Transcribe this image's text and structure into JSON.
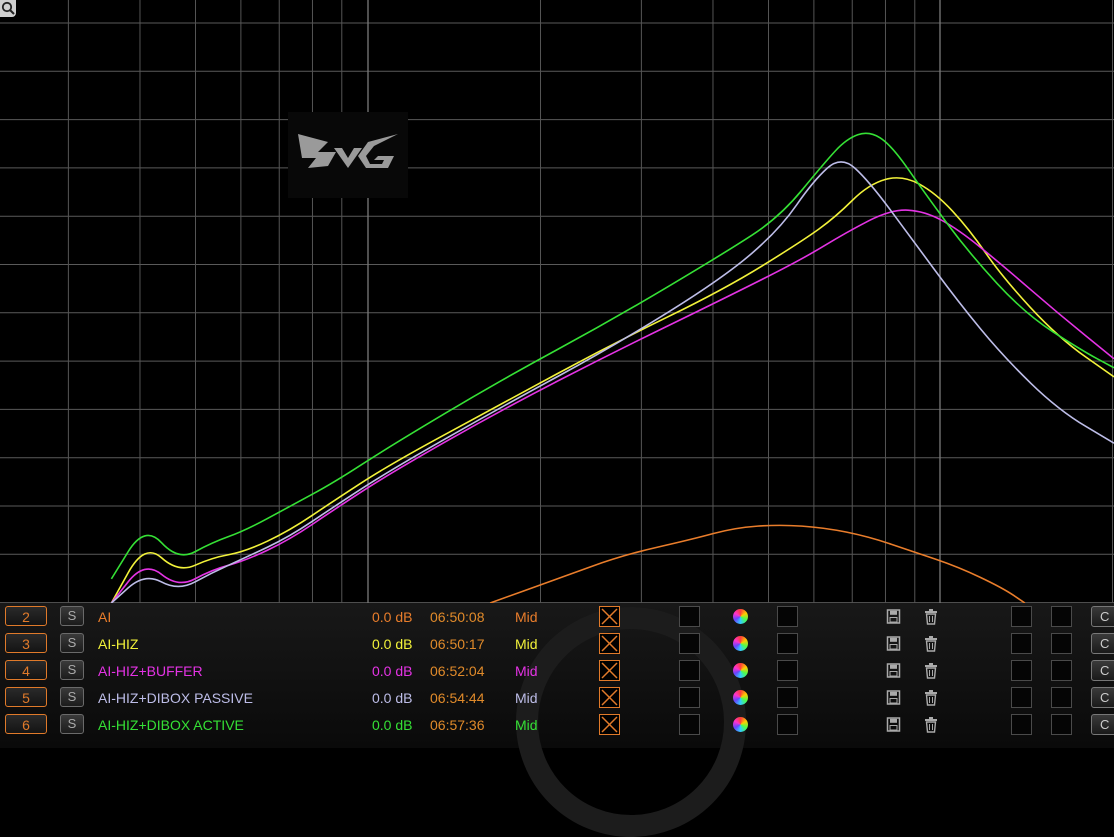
{
  "toolbar": {
    "zoom_icon": "magnifier-icon"
  },
  "logo": {
    "icon": "brand-logo-icon"
  },
  "traces": [
    {
      "number": "2",
      "solo_label": "S",
      "name": "AI",
      "level": "0.0 dB",
      "time": "06:50:08",
      "smoothing": "Mid",
      "color": "#e97d2b"
    },
    {
      "number": "3",
      "solo_label": "S",
      "name": "AI-HIZ",
      "level": "0.0 dB",
      "time": "06:50:17",
      "smoothing": "Mid",
      "color": "#f2f23a"
    },
    {
      "number": "4",
      "solo_label": "S",
      "name": "AI-HIZ+BUFFER",
      "level": "0.0 dB",
      "time": "06:52:04",
      "smoothing": "Mid",
      "color": "#e433e4"
    },
    {
      "number": "5",
      "solo_label": "S",
      "name": "AI-HIZ+DIBOX PASSIVE",
      "level": "0.0 dB",
      "time": "06:54:44",
      "smoothing": "Mid",
      "color": "#bdbde8"
    },
    {
      "number": "6",
      "solo_label": "S",
      "name": "AI-HIZ+DIBOX ACTIVE",
      "level": "0.0 dB",
      "time": "06:57:36",
      "smoothing": "Mid",
      "color": "#35e035"
    }
  ],
  "row_edge_button_label": "C",
  "chart_data": {
    "type": "line",
    "grid": true,
    "x_scale": "log",
    "series": [
      {
        "name": "AI",
        "color": "#e97d2b",
        "points": [
          [
            0.44,
            1.0
          ],
          [
            0.5,
            0.96
          ],
          [
            0.56,
            0.92
          ],
          [
            0.62,
            0.895
          ],
          [
            0.66,
            0.875
          ],
          [
            0.7,
            0.87
          ],
          [
            0.74,
            0.875
          ],
          [
            0.78,
            0.89
          ],
          [
            0.82,
            0.915
          ],
          [
            0.86,
            0.94
          ],
          [
            0.9,
            0.975
          ],
          [
            0.92,
            1.0
          ]
        ]
      },
      {
        "name": "AI-HIZ",
        "color": "#f2f23a",
        "points": [
          [
            0.1,
            1.0
          ],
          [
            0.13,
            0.9
          ],
          [
            0.16,
            0.95
          ],
          [
            0.19,
            0.925
          ],
          [
            0.22,
            0.915
          ],
          [
            0.26,
            0.88
          ],
          [
            0.3,
            0.83
          ],
          [
            0.35,
            0.77
          ],
          [
            0.45,
            0.67
          ],
          [
            0.55,
            0.57
          ],
          [
            0.65,
            0.48
          ],
          [
            0.72,
            0.4
          ],
          [
            0.75,
            0.36
          ],
          [
            0.78,
            0.305
          ],
          [
            0.81,
            0.29
          ],
          [
            0.84,
            0.32
          ],
          [
            0.87,
            0.38
          ],
          [
            0.9,
            0.46
          ],
          [
            0.95,
            0.56
          ],
          [
            1.0,
            0.625
          ]
        ]
      },
      {
        "name": "AI-HIZ+BUFFER",
        "color": "#e433e4",
        "points": [
          [
            0.1,
            1.0
          ],
          [
            0.13,
            0.93
          ],
          [
            0.16,
            0.975
          ],
          [
            0.19,
            0.945
          ],
          [
            0.22,
            0.93
          ],
          [
            0.26,
            0.895
          ],
          [
            0.3,
            0.845
          ],
          [
            0.35,
            0.785
          ],
          [
            0.45,
            0.68
          ],
          [
            0.55,
            0.585
          ],
          [
            0.65,
            0.495
          ],
          [
            0.72,
            0.43
          ],
          [
            0.76,
            0.385
          ],
          [
            0.8,
            0.347
          ],
          [
            0.83,
            0.35
          ],
          [
            0.86,
            0.38
          ],
          [
            0.9,
            0.44
          ],
          [
            0.95,
            0.52
          ],
          [
            1.0,
            0.595
          ]
        ]
      },
      {
        "name": "AI-HIZ+DIBOX PASSIVE",
        "color": "#bdbde8",
        "points": [
          [
            0.1,
            1.0
          ],
          [
            0.13,
            0.95
          ],
          [
            0.16,
            0.98
          ],
          [
            0.19,
            0.95
          ],
          [
            0.22,
            0.925
          ],
          [
            0.26,
            0.89
          ],
          [
            0.3,
            0.84
          ],
          [
            0.35,
            0.78
          ],
          [
            0.45,
            0.675
          ],
          [
            0.55,
            0.575
          ],
          [
            0.65,
            0.46
          ],
          [
            0.7,
            0.38
          ],
          [
            0.73,
            0.3
          ],
          [
            0.755,
            0.258
          ],
          [
            0.78,
            0.3
          ],
          [
            0.82,
            0.4
          ],
          [
            0.86,
            0.5
          ],
          [
            0.9,
            0.59
          ],
          [
            0.95,
            0.68
          ],
          [
            1.0,
            0.735
          ]
        ]
      },
      {
        "name": "AI-HIZ+DIBOX ACTIVE",
        "color": "#35e035",
        "points": [
          [
            0.1,
            0.96
          ],
          [
            0.13,
            0.87
          ],
          [
            0.16,
            0.93
          ],
          [
            0.19,
            0.9
          ],
          [
            0.22,
            0.88
          ],
          [
            0.26,
            0.84
          ],
          [
            0.3,
            0.8
          ],
          [
            0.35,
            0.74
          ],
          [
            0.45,
            0.63
          ],
          [
            0.55,
            0.53
          ],
          [
            0.65,
            0.42
          ],
          [
            0.7,
            0.36
          ],
          [
            0.74,
            0.27
          ],
          [
            0.76,
            0.23
          ],
          [
            0.78,
            0.217
          ],
          [
            0.8,
            0.24
          ],
          [
            0.83,
            0.32
          ],
          [
            0.87,
            0.42
          ],
          [
            0.92,
            0.52
          ],
          [
            0.97,
            0.58
          ],
          [
            1.0,
            0.61
          ]
        ]
      }
    ]
  }
}
